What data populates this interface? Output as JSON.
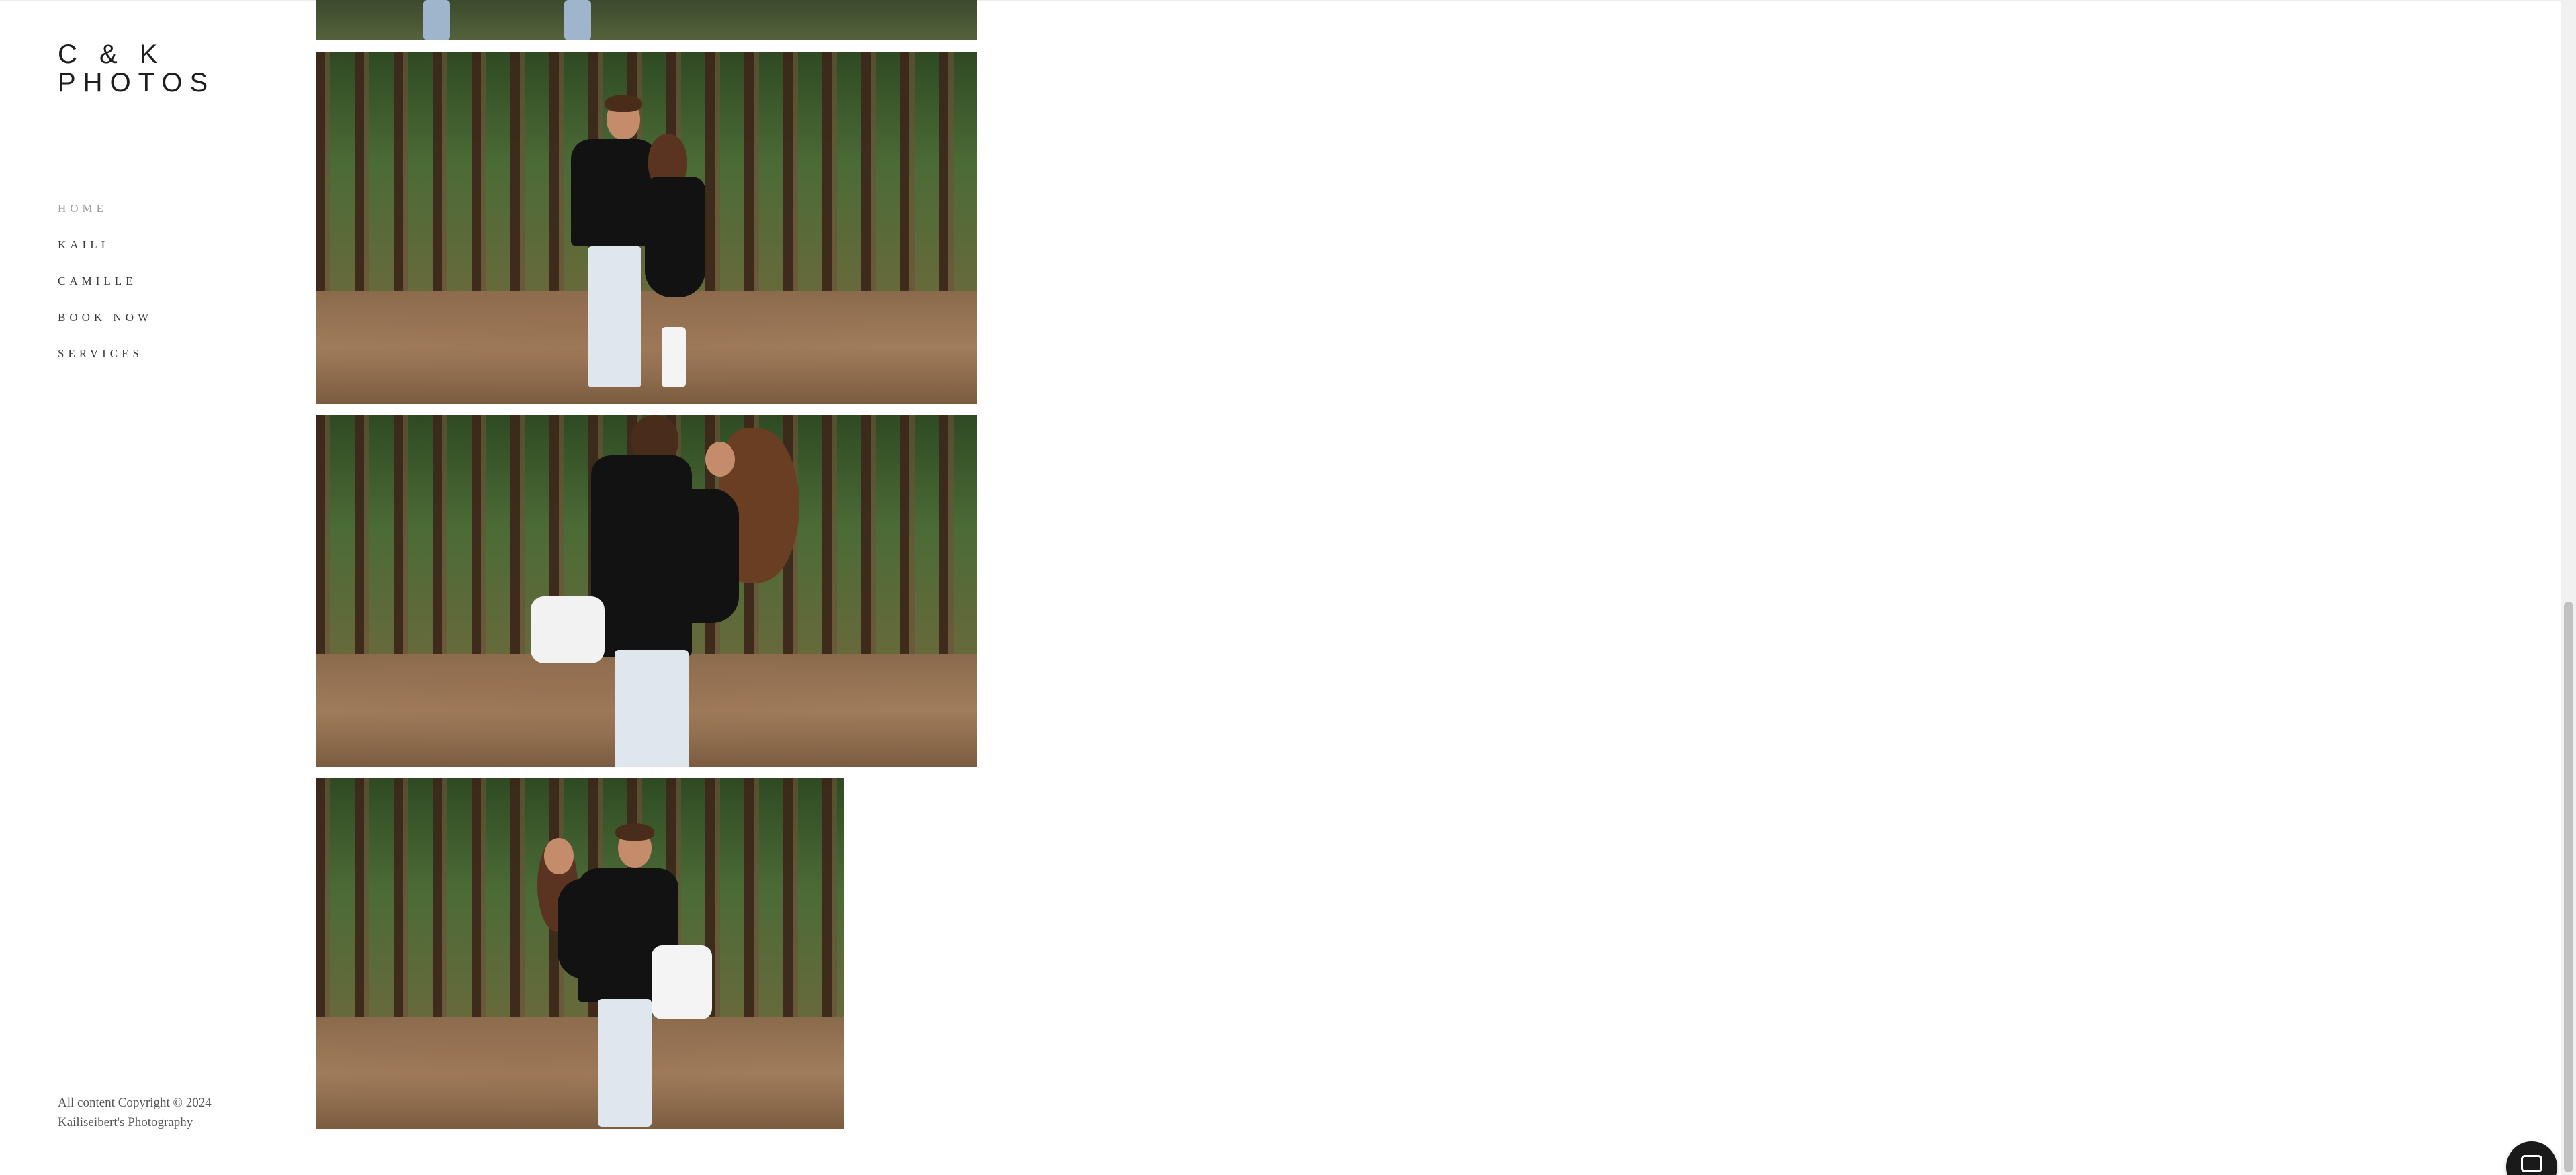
{
  "site": {
    "logo_line1": "C & K",
    "logo_line2": "PHOTOS"
  },
  "nav": {
    "items": [
      {
        "label": "HOME",
        "active": true
      },
      {
        "label": "KAILI",
        "active": false
      },
      {
        "label": "CAMILLE",
        "active": false
      },
      {
        "label": "BOOK NOW",
        "active": false
      },
      {
        "label": "SERVICES",
        "active": false
      }
    ]
  },
  "footer": {
    "copyright": "All content Copyright © 2024 Kailiseibert's Photography"
  },
  "gallery": {
    "images": [
      {
        "name": "gallery-photo-1",
        "subject": "couple photo (cropped, top)"
      },
      {
        "name": "gallery-photo-2",
        "subject": "couple standing holding hands in pine forest"
      },
      {
        "name": "gallery-photo-3",
        "subject": "couple embracing in pine forest"
      },
      {
        "name": "gallery-photo-4",
        "subject": "man carrying woman in pine forest"
      }
    ]
  },
  "colors": {
    "nav_active": "#9a9a9a",
    "nav_text": "#3a3a3a",
    "logo": "#1e1e1e"
  },
  "icons": {
    "chat": "chat-bubble-icon"
  }
}
